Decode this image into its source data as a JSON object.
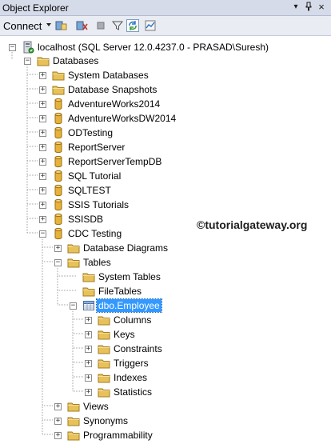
{
  "window": {
    "title": "Object Explorer",
    "controls": [
      "▾",
      "ᵖ",
      "×"
    ]
  },
  "toolbar": {
    "connect_label": "Connect",
    "icons": [
      "connect-object-explorer-icon",
      "disconnect-icon",
      "stop-icon",
      "filter-icon",
      "refresh-icon",
      "activity-monitor-icon"
    ]
  },
  "tree": {
    "server": "localhost (SQL Server 12.0.4237.0 - PRASAD\\Suresh)",
    "databases": "Databases",
    "system_databases": "System Databases",
    "database_snapshots": "Database Snapshots",
    "db_list": [
      "AdventureWorks2014",
      "AdventureWorksDW2014",
      "ODTesting",
      "ReportServer",
      "ReportServerTempDB",
      "SQL Tutorial",
      "SQLTEST",
      "SSIS Tutorials",
      "SSISDB"
    ],
    "cdc_testing": "CDC Testing",
    "database_diagrams": "Database Diagrams",
    "tables": "Tables",
    "system_tables": "System Tables",
    "file_tables": "FileTables",
    "employee_table": "dbo.Employee",
    "table_children": [
      "Columns",
      "Keys",
      "Constraints",
      "Triggers",
      "Indexes",
      "Statistics"
    ],
    "views": "Views",
    "synonyms": "Synonyms",
    "programmability": "Programmability"
  },
  "watermark": "©tutorialgateway.org",
  "colors": {
    "selection": "#3399ff",
    "folder": "#e8c15a",
    "database": "#d8a22a"
  }
}
